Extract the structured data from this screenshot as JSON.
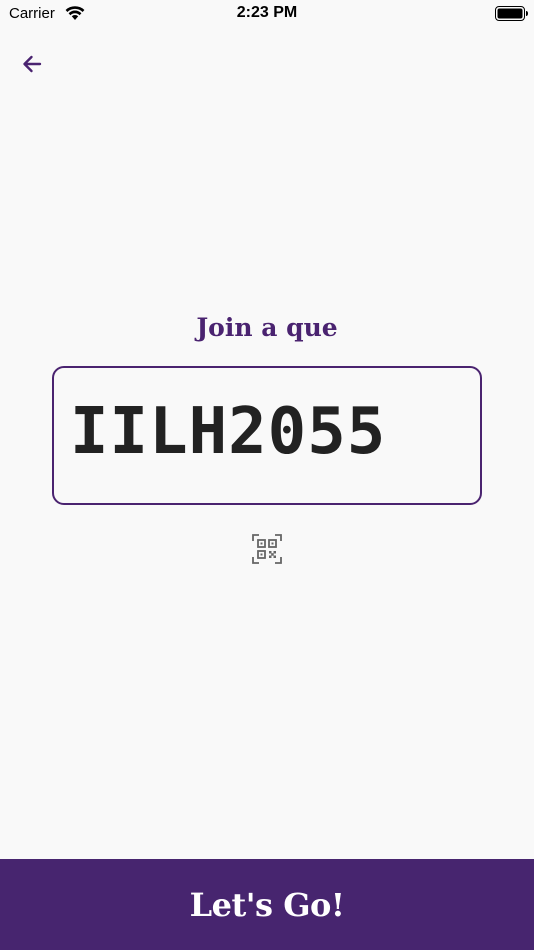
{
  "status_bar": {
    "carrier": "Carrier",
    "time": "2:23 PM"
  },
  "icons": {
    "back": "arrow-left-icon",
    "wifi": "wifi-icon",
    "battery": "battery-icon",
    "qr": "qr-code-scan-icon"
  },
  "colors": {
    "accent": "#4a2370",
    "bottom_bar": "#47256f",
    "background": "#f9f9f9"
  },
  "main": {
    "title": "Join a que",
    "code_value": "IILH2055"
  },
  "footer": {
    "button_label": "Let's Go!"
  }
}
